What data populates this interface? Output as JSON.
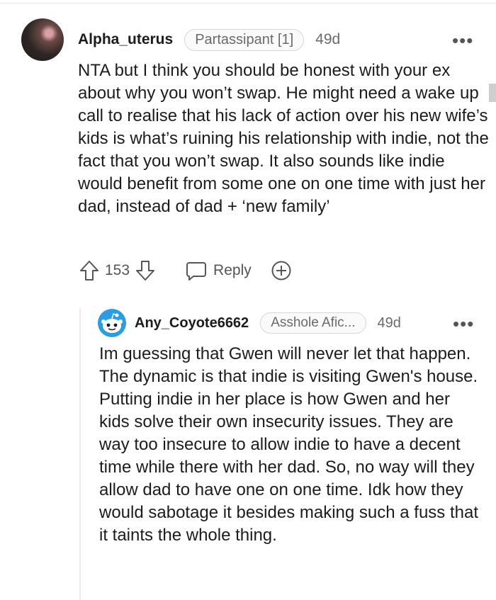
{
  "comment": {
    "author": "Alpha_uterus",
    "flair": "Partassipant [1]",
    "age": "49d",
    "more": "•••",
    "body": "NTA but I think you should be honest with your ex about why you won’t swap. He might need a wake up call to realise that his lack of action over his new wife’s kids is what’s ruining his relationship with indie, not the fact that you won’t swap. It also sounds like indie would benefit from some one on one time with just her dad, instead of dad + ‘new family’",
    "upvotes": "153",
    "reply_label": "Reply"
  },
  "reply": {
    "author": "Any_Coyote6662",
    "flair": "Asshole Afic...",
    "age": "49d",
    "more": "•••",
    "body": "Im guessing that Gwen will never let that happen. The dynamic is that indie is visiting Gwen's house. Putting indie in her place is how Gwen and her kids solve their own insecurity issues. They are way too insecure to allow indie to have a decent time while there with her dad. So, no way will they allow dad to have one on one time. Idk how they would sabotage it besides making such a fuss that it taints the whole thing."
  },
  "colors": {
    "text": "#1c1c1c",
    "meta": "#6a6a6a",
    "avatar_blue": "#2b9de0"
  },
  "icons": [
    "upvote-icon",
    "downvote-icon",
    "comment-bubble-icon",
    "award-icon",
    "more-options-icon",
    "snoo-avatar-icon"
  ]
}
